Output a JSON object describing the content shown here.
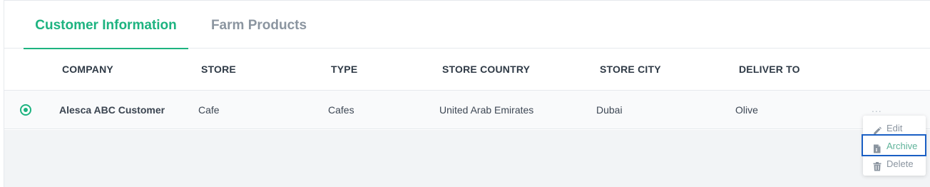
{
  "tabs": [
    {
      "label": "Customer Information",
      "active": true
    },
    {
      "label": "Farm Products",
      "active": false
    }
  ],
  "table": {
    "columns": [
      "COMPANY",
      "STORE",
      "TYPE",
      "STORE COUNTRY",
      "STORE CITY",
      "DELIVER TO"
    ],
    "rows": [
      {
        "selected": true,
        "company": "Alesca ABC Customer",
        "store": "Cafe",
        "type": "Cafes",
        "store_country": "United Arab Emirates",
        "store_city": "Dubai",
        "deliver_to": "Olive",
        "more_label": "..."
      }
    ]
  },
  "row_menu": {
    "items": [
      {
        "label": "Edit",
        "icon": "pencil-icon"
      },
      {
        "label": "Archive",
        "icon": "archive-file-icon",
        "highlighted": true
      },
      {
        "label": "Delete",
        "icon": "trash-icon"
      }
    ]
  },
  "colors": {
    "accent": "#1db380",
    "focus_outline": "#1a5fc4",
    "muted_text": "#8b95a0"
  }
}
